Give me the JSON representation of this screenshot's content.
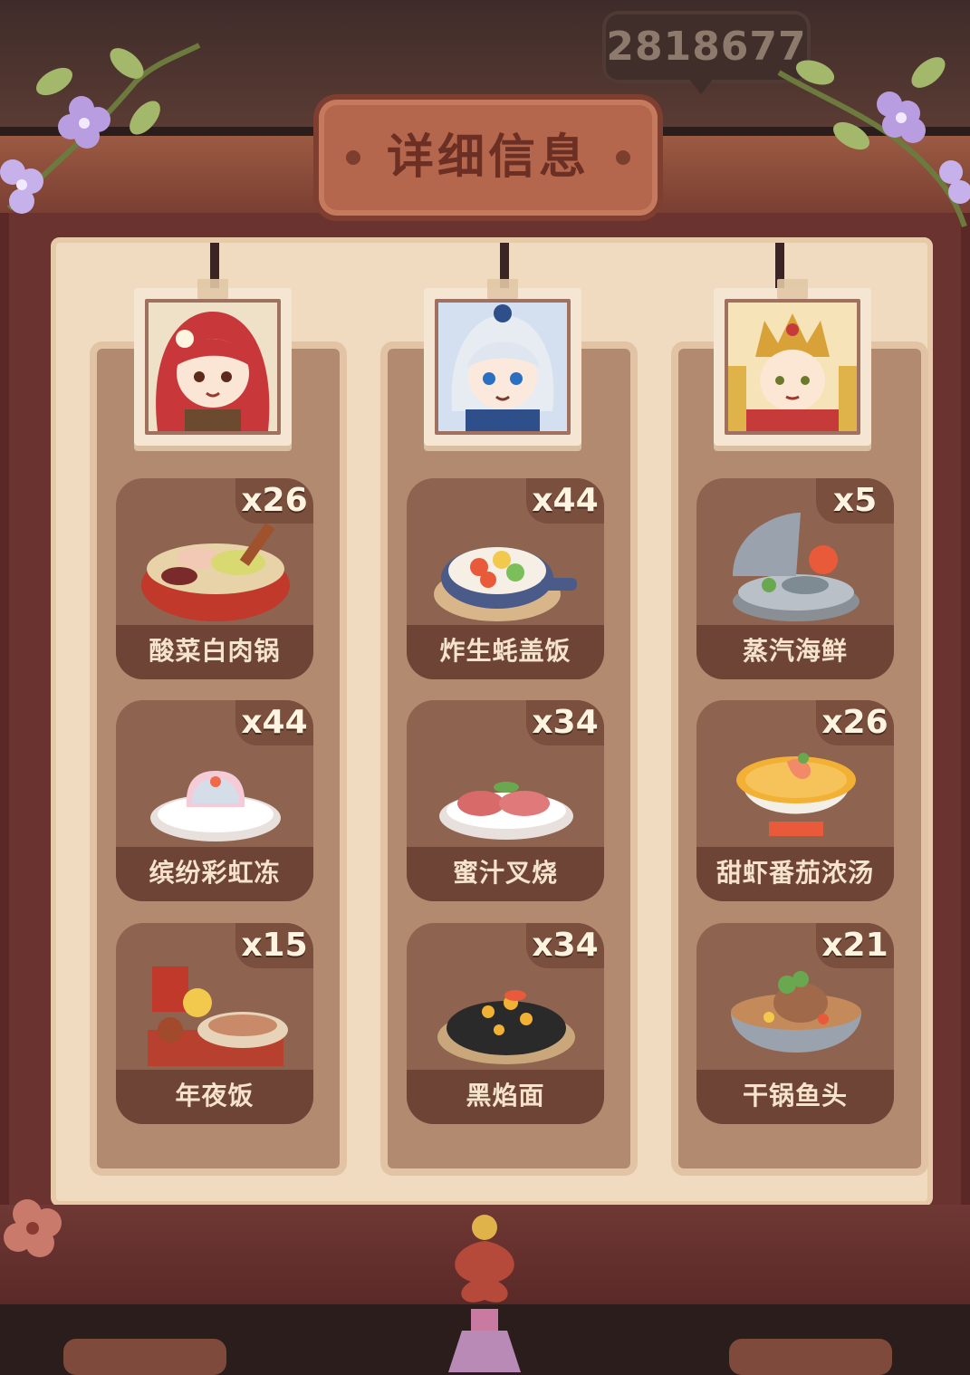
{
  "currency": {
    "amount": "2818677"
  },
  "title": "详细信息",
  "columns": [
    {
      "character": "red-haired-girl-portrait",
      "dishes": [
        {
          "name": "酸菜白肉锅",
          "count": "x26",
          "icon": "pot-dish-icon"
        },
        {
          "name": "缤纷彩虹冻",
          "count": "x44",
          "icon": "jelly-dish-icon"
        },
        {
          "name": "年夜饭",
          "count": "x15",
          "icon": "feast-dish-icon"
        }
      ]
    },
    {
      "character": "silver-haired-boy-portrait",
      "dishes": [
        {
          "name": "炸生蚝盖饭",
          "count": "x44",
          "icon": "rice-bowl-dish-icon"
        },
        {
          "name": "蜜汁叉烧",
          "count": "x34",
          "icon": "bbq-pork-dish-icon"
        },
        {
          "name": "黑焰面",
          "count": "x34",
          "icon": "black-noodle-dish-icon"
        }
      ]
    },
    {
      "character": "crowned-deity-portrait",
      "dishes": [
        {
          "name": "蒸汽海鲜",
          "count": "x5",
          "icon": "steamed-seafood-dish-icon"
        },
        {
          "name": "甜虾番茄浓汤",
          "count": "x26",
          "icon": "shrimp-soup-dish-icon"
        },
        {
          "name": "干锅鱼头",
          "count": "x21",
          "icon": "fish-head-pot-dish-icon"
        }
      ]
    }
  ],
  "colors": {
    "frame": "#6a3330",
    "panel": "#f1dbc0",
    "card": "#8e6350",
    "label_bg": "#6e4436",
    "label_text": "#f5e3cc",
    "title_plate": "#b4674c"
  }
}
